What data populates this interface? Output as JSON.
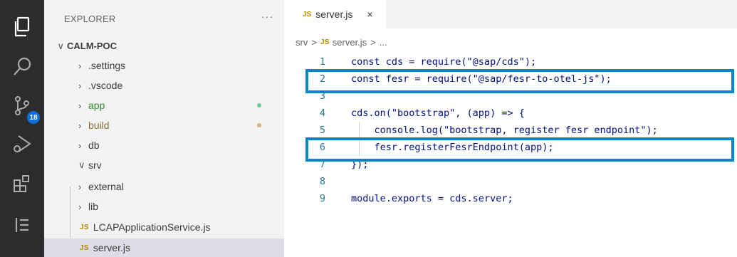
{
  "activity_bar": {
    "icons": [
      "explorer-icon",
      "search-icon",
      "source-control-icon",
      "run-debug-icon",
      "extensions-icon",
      "list-icon"
    ],
    "scm_badge": "18"
  },
  "explorer": {
    "title": "EXPLORER",
    "more": "···",
    "section": "CALM-POC",
    "items": [
      {
        "label": ".settings"
      },
      {
        "label": ".vscode"
      },
      {
        "label": "app"
      },
      {
        "label": "build"
      },
      {
        "label": "db"
      },
      {
        "label": "srv"
      },
      {
        "label": "external"
      },
      {
        "label": "lib"
      },
      {
        "label": "LCAPApplicationService.js"
      },
      {
        "label": "server.js"
      }
    ],
    "js_tag": "JS"
  },
  "editor": {
    "tab_label": "server.js",
    "tab_close": "×",
    "js_tag": "JS",
    "breadcrumb": [
      "srv",
      ">",
      "server.js",
      ">",
      "..."
    ],
    "lines": [
      {
        "n": "1",
        "code": "const cds = require(\"@sap/cds\");"
      },
      {
        "n": "2",
        "code": "const fesr = require(\"@sap/fesr-to-otel-js\");"
      },
      {
        "n": "3",
        "code": ""
      },
      {
        "n": "4",
        "code": "cds.on(\"bootstrap\", (app) => {"
      },
      {
        "n": "5",
        "code": "    console.log(\"bootstrap, register fesr endpoint\");"
      },
      {
        "n": "6",
        "code": "    fesr.registerFesrEndpoint(app);"
      },
      {
        "n": "7",
        "code": "});"
      },
      {
        "n": "8",
        "code": ""
      },
      {
        "n": "9",
        "code": "module.exports = cds.server;"
      }
    ]
  },
  "colors": {
    "highlight": "#0a84c6",
    "git_added": "#73c991",
    "git_modified": "#d7b47f"
  }
}
